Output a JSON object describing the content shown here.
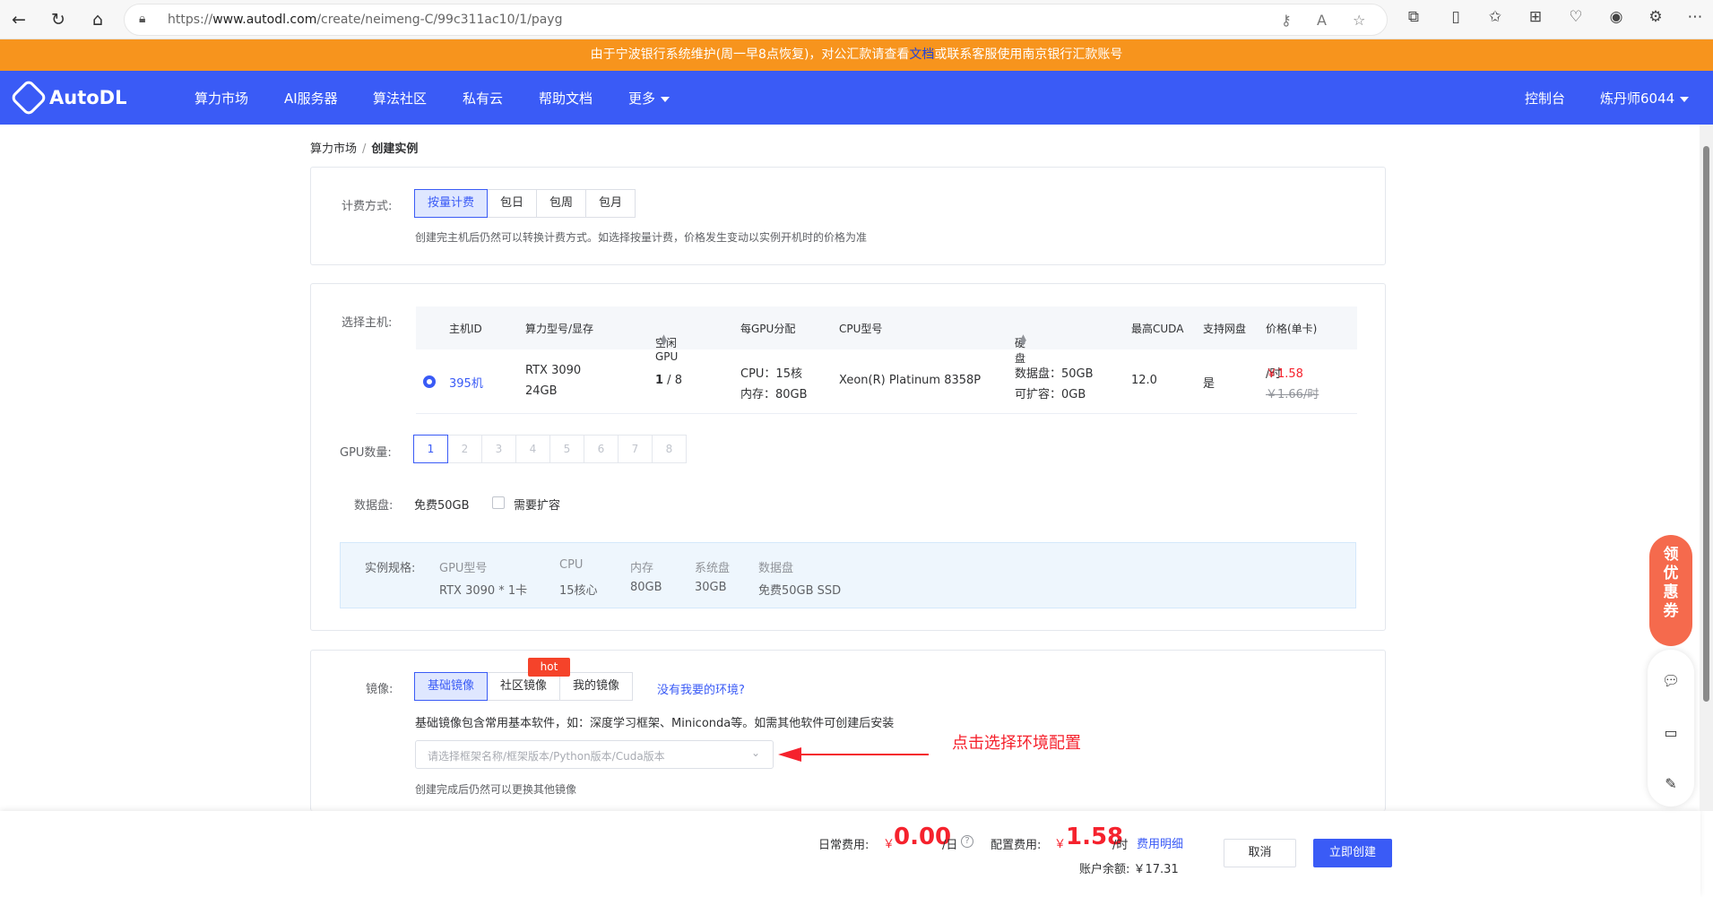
{
  "browser": {
    "url_prefix": "https://",
    "url_host": "www.autodl.com",
    "url_path": "/create/neimeng-C/99c311ac10/1/payg"
  },
  "notice": {
    "text_before": "由于宁波银行系统维护(周一早8点恢复)，对公汇款请查看",
    "link": "文档",
    "text_after": "或联系客服使用南京银行汇款账号"
  },
  "nav": {
    "brand": "AutoDL",
    "items": [
      "算力市场",
      "AI服务器",
      "算法社区",
      "私有云",
      "帮助文档",
      "更多"
    ],
    "console": "控制台",
    "user": "炼丹师6044"
  },
  "breadcrumb": {
    "parent": "算力市场",
    "sep": "/",
    "current": "创建实例"
  },
  "billing": {
    "label": "计费方式:",
    "options": [
      "按量计费",
      "包日",
      "包周",
      "包月"
    ],
    "hint": "创建完主机后仍然可以转换计费方式。如选择按量计费，价格发生变动以实例开机时的价格为准"
  },
  "host": {
    "label": "选择主机:",
    "headers": [
      "主机ID",
      "算力型号/显存",
      "空闲GPU",
      "每GPU分配",
      "CPU型号",
      "硬盘",
      "最高CUDA",
      "支持网盘",
      "价格(单卡)"
    ],
    "row": {
      "id": "395机",
      "gpu_model": "RTX 3090",
      "vram": "24GB",
      "free_gpu": "1",
      "total_gpu": " / 8",
      "cpu_alloc": "CPU：15核",
      "mem_alloc": "内存：80GB",
      "cpu_model": "Xeon(R) Platinum 8358P",
      "disk_data": "数据盘：50GB",
      "disk_expand": "可扩容：0GB",
      "cuda": "12.0",
      "netdisk": "是",
      "price": "￥1.58",
      "price_unit": "/时",
      "price_old": "￥1.66/时"
    }
  },
  "gpu_count": {
    "label": "GPU数量:",
    "options": [
      "1",
      "2",
      "3",
      "4",
      "5",
      "6",
      "7",
      "8"
    ]
  },
  "data_disk": {
    "label": "数据盘:",
    "free": "免费50GB",
    "expand": "需要扩容"
  },
  "spec": {
    "label": "实例规格:",
    "cols": [
      {
        "h": "GPU型号",
        "v": "RTX 3090 * 1卡"
      },
      {
        "h": "CPU",
        "v": "15核心"
      },
      {
        "h": "内存",
        "v": "80GB"
      },
      {
        "h": "系统盘",
        "v": "30GB"
      },
      {
        "h": "数据盘",
        "v": "免费50GB SSD"
      }
    ]
  },
  "image": {
    "label": "镜像:",
    "tabs": [
      "基础镜像",
      "社区镜像",
      "我的镜像"
    ],
    "hot": "hot",
    "no_env": "没有我要的环境?",
    "desc": "基础镜像包含常用基本软件，如：深度学习框架、Miniconda等。如需其他软件可创建后安装",
    "placeholder": "请选择框架名称/框架版本/Python版本/Cuda版本",
    "hint": "创建完成后仍然可以更换其他镜像",
    "annotation": "点击选择环境配置"
  },
  "footer": {
    "daily_label": "日常费用:",
    "daily_currency": "￥",
    "daily_value": "0.00",
    "daily_unit": "/日",
    "config_label": "配置费用:",
    "config_currency": "￥",
    "config_value": "1.58",
    "config_unit": "/时",
    "detail": "费用明细",
    "balance": "账户余额: ￥17.31",
    "cancel": "取消",
    "create": "立即创建"
  },
  "promo": {
    "text": "领优惠券"
  },
  "colors": {
    "primary": "#3a5bf6",
    "notice": "#f7941d",
    "price": "#f5222d"
  }
}
